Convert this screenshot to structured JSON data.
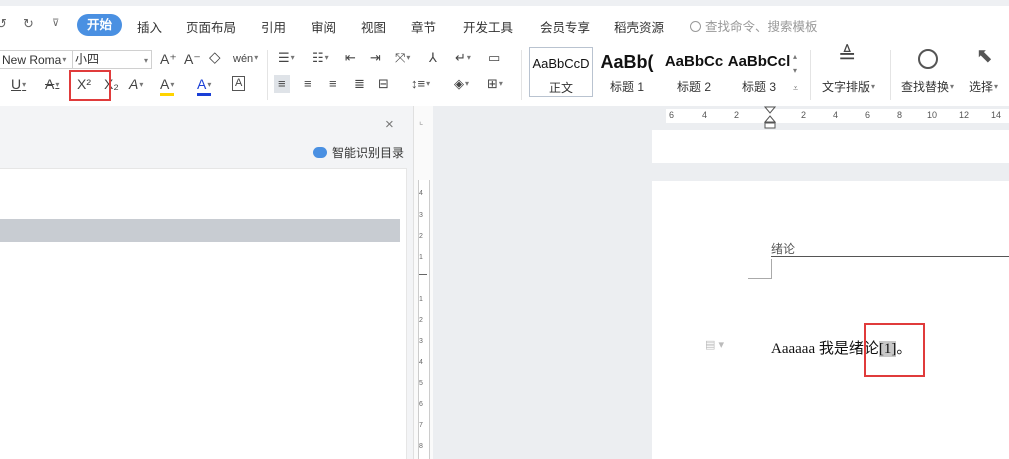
{
  "menubar": {
    "quick_redo": "↻",
    "quick_more": "⊽",
    "tabs": [
      {
        "label": "开始",
        "active": true
      },
      {
        "label": "插入"
      },
      {
        "label": "页面布局"
      },
      {
        "label": "引用"
      },
      {
        "label": "审阅"
      },
      {
        "label": "视图"
      },
      {
        "label": "章节"
      },
      {
        "label": "开发工具"
      },
      {
        "label": "会员专享"
      },
      {
        "label": "稻壳资源"
      }
    ],
    "search_placeholder": "查找命令、搜索模板"
  },
  "toolbar": {
    "font_name": "New Roma",
    "font_size": "小四",
    "grow_font": "A⁺",
    "shrink_font": "A⁻",
    "clear_format": "◇",
    "phonetic": "wén",
    "underline": "U",
    "strikethrough": "A",
    "superscript": "X²",
    "subscript": "X₂",
    "text_effect": "A",
    "highlight": "A",
    "font_color": "A",
    "char_border": "A",
    "styles": [
      {
        "preview": "AaBbCcD",
        "name": "正文",
        "selected": true
      },
      {
        "preview": "AaBb(",
        "name": "标题 1"
      },
      {
        "preview": "AaBbCc",
        "name": "标题 2"
      },
      {
        "preview": "AaBbCcl",
        "name": "标题 3"
      }
    ],
    "text_layout_label": "文字排版",
    "find_replace_label": "查找替换",
    "select_label": "选择",
    "colors": {
      "highlight": "#ffd400",
      "font_color": "#1a3fd6",
      "accent": "#4a90e2",
      "annotation": "#e03b3b"
    }
  },
  "nav_panel": {
    "close": "×",
    "smart_toc_label": "智能识别目录"
  },
  "ruler": {
    "h_labels": [
      "6",
      "4",
      "2",
      "2",
      "4",
      "6",
      "8",
      "10",
      "12",
      "14"
    ],
    "v_labels": [
      "4",
      "3",
      "2",
      "1",
      "1",
      "2",
      "3",
      "4",
      "5",
      "6",
      "7",
      "8"
    ]
  },
  "document": {
    "header_text": "绪论",
    "body_text": "Aaaaaa  我是绪论",
    "reference": "[1]",
    "end_punct": "。"
  }
}
